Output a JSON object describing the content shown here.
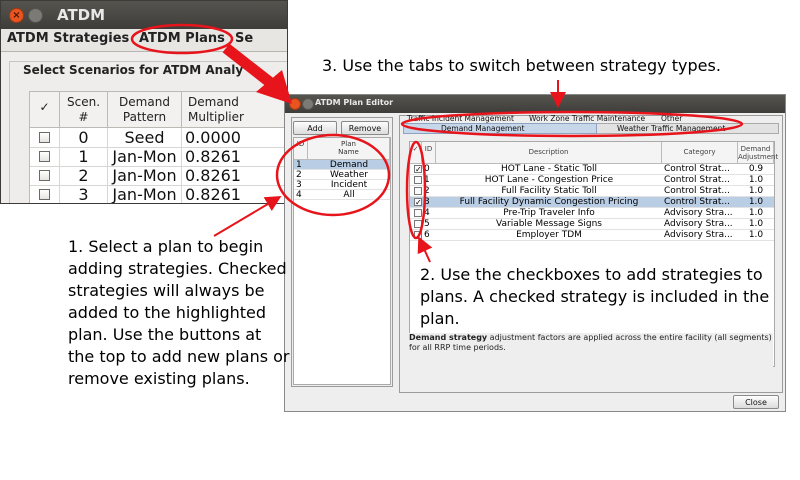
{
  "atdm_window": {
    "title": "ATDM",
    "tabs": [
      "ATDM Strategies",
      "ATDM Plans",
      "Se"
    ],
    "group_title": "Select Scenarios for ATDM Analy",
    "columns": [
      "✓",
      "Scen.\n#",
      "Demand\nPattern",
      "Demand\nMultiplier"
    ],
    "rows": [
      {
        "scen": "0",
        "pattern": "Seed",
        "multiplier": "0.0000",
        "checked": false
      },
      {
        "scen": "1",
        "pattern": "Jan-Mon",
        "multiplier": "0.8261",
        "checked": false
      },
      {
        "scen": "2",
        "pattern": "Jan-Mon",
        "multiplier": "0.8261",
        "checked": false
      },
      {
        "scen": "3",
        "pattern": "Jan-Mon",
        "multiplier": "0.8261",
        "checked": false
      }
    ]
  },
  "plan_editor": {
    "title": "ATDM Plan Editor",
    "add_label": "Add",
    "remove_label": "Remove",
    "plan_columns": [
      "ID",
      "Plan\nName"
    ],
    "plans": [
      {
        "id": "1",
        "name": "Demand",
        "selected": true
      },
      {
        "id": "2",
        "name": "Weather",
        "selected": false
      },
      {
        "id": "3",
        "name": "Incident",
        "selected": false
      },
      {
        "id": "4",
        "name": "All",
        "selected": false
      }
    ],
    "tabs_top": [
      "Traffic Incident Management",
      "Work Zone Traffic Maintenance",
      "Other"
    ],
    "tabs_bottom": [
      "Demand Management",
      "Weather Traffic Management"
    ],
    "strategy_columns": [
      "✓",
      "ID",
      "Description",
      "Category",
      "Demand\nAdjustment"
    ],
    "strategies": [
      {
        "id": "0",
        "description": "HOT Lane - Static Toll",
        "category": "Control Strat...",
        "adjustment": "0.9",
        "checked": true,
        "selected": false
      },
      {
        "id": "1",
        "description": "HOT Lane - Congestion Price",
        "category": "Control Strat...",
        "adjustment": "1.0",
        "checked": false,
        "selected": false
      },
      {
        "id": "2",
        "description": "Full Facility Static Toll",
        "category": "Control Strat...",
        "adjustment": "1.0",
        "checked": false,
        "selected": false
      },
      {
        "id": "3",
        "description": "Full Facility Dynamic Congestion Pricing",
        "category": "Control Strat...",
        "adjustment": "1.0",
        "checked": true,
        "selected": true
      },
      {
        "id": "4",
        "description": "Pre-Trip Traveler Info",
        "category": "Advisory Stra...",
        "adjustment": "1.0",
        "checked": false,
        "selected": false
      },
      {
        "id": "5",
        "description": "Variable Message Signs",
        "category": "Advisory Stra...",
        "adjustment": "1.0",
        "checked": false,
        "selected": false
      },
      {
        "id": "6",
        "description": "Employer TDM",
        "category": "Advisory Stra...",
        "adjustment": "1.0",
        "checked": false,
        "selected": false
      }
    ],
    "description_bold": "Demand strategy",
    "description_rest": " adjustment factors are applied across the entire facility (all segments) for all RRP time periods.",
    "close_label": "Close"
  },
  "annotations": {
    "note1": "1. Select a plan to begin adding strategies. Checked strategies will always be added to the highlighted plan.  Use the buttons at the top to add new plans or remove existing plans.",
    "note2": "2. Use the checkboxes to add strategies to plans.  A checked strategy is included in the plan.",
    "note3": "3. Use the tabs to switch between strategy types."
  },
  "colors": {
    "annotation_red": "#e8141b",
    "selected_row": "#b9cde5",
    "titlebar": "#3e3d39",
    "close_orange": "#e95420"
  }
}
